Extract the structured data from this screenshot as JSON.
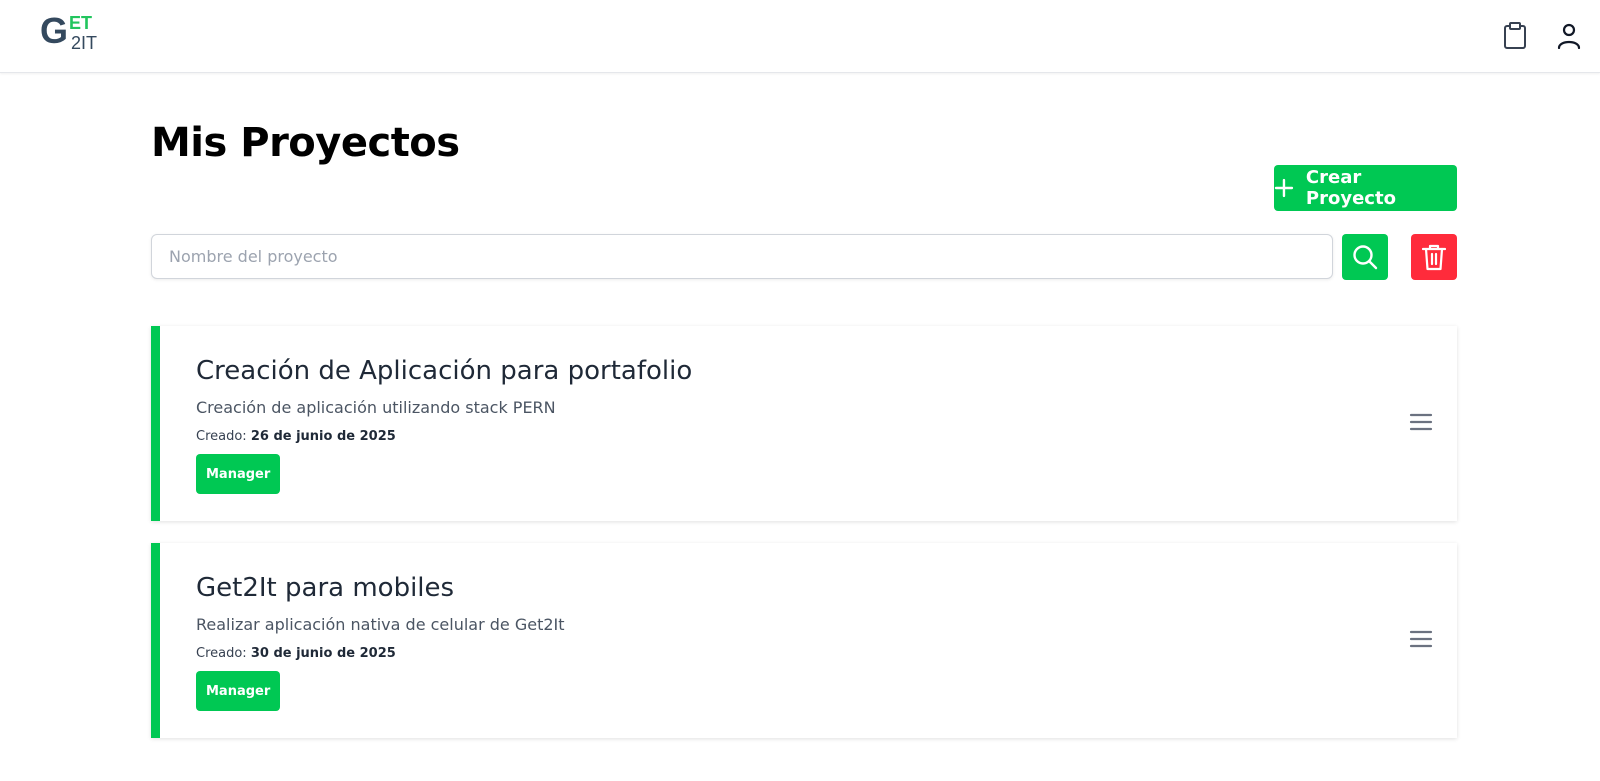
{
  "brand": {
    "letter_g": "G",
    "letters_et": "ET",
    "letters_2it": "2IT",
    "accent_color": "#22c55e",
    "dark_color": "#34495e"
  },
  "header": {
    "icons": [
      "clipboard-icon",
      "user-icon"
    ]
  },
  "main": {
    "title": "Mis Proyectos",
    "create_button_label": "Crear Proyecto",
    "search": {
      "placeholder": "Nombre del proyecto",
      "value": ""
    },
    "icons": {
      "search": "search-icon",
      "clear": "trash-icon"
    }
  },
  "projects": [
    {
      "title": "Creación de Aplicación para portafolio",
      "description": "Creación de aplicación utilizando stack PERN",
      "created_label": "Creado:",
      "created_date": "26 de junio de 2025",
      "role": "Manager"
    },
    {
      "title": "Get2It para mobiles",
      "description": "Realizar aplicación nativa de celular de Get2It",
      "created_label": "Creado:",
      "created_date": "30 de junio de 2025",
      "role": "Manager"
    }
  ],
  "colors": {
    "primary": "#00c853",
    "danger": "#ff2b3b",
    "border": "#d1d5db"
  }
}
